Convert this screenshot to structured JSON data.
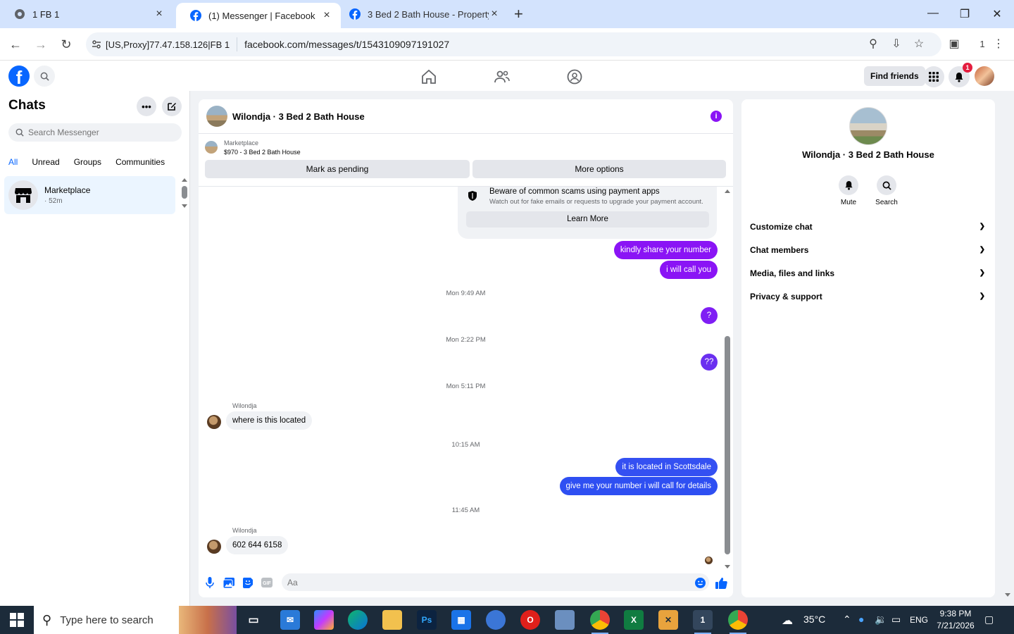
{
  "browser": {
    "tabs": [
      {
        "title": "1 FB 1",
        "active": false
      },
      {
        "title": "(1) Messenger | Facebook",
        "active": true
      },
      {
        "title": "3 Bed 2 Bath House - Property r",
        "active": false
      }
    ],
    "proxy_label": "[US,Proxy]77.47.158.126|FB 1",
    "url": "facebook.com/messages/t/1543109097191027",
    "profile_count": "1"
  },
  "fb_header": {
    "find_friends_label": "Find friends",
    "notification_count": "1"
  },
  "sidebar": {
    "title": "Chats",
    "search_placeholder": "Search Messenger",
    "filters": [
      "All",
      "Unread",
      "Groups",
      "Communities"
    ],
    "active_filter": "All",
    "chats": [
      {
        "name": "Marketplace",
        "time": "· 52m"
      }
    ]
  },
  "conversation": {
    "title": "Wilondja · 3 Bed 2 Bath House",
    "marketplace": {
      "label": "Marketplace",
      "listing": "$970 - 3 Bed 2 Bath House",
      "mark_pending_label": "Mark as pending",
      "more_options_label": "More options"
    },
    "scam_notice": {
      "title": "Beware of common scams using payment apps",
      "body": "Watch out for fake emails or requests to upgrade your payment account.",
      "button": "Learn More"
    },
    "messages": [
      {
        "from": "me",
        "text": "kindly share your number"
      },
      {
        "from": "me",
        "text": "i will call you"
      },
      {
        "timestamp": "Mon 9:49 AM"
      },
      {
        "from": "me",
        "text": "?"
      },
      {
        "timestamp": "Mon 2:22 PM"
      },
      {
        "from": "me",
        "text": "??"
      },
      {
        "timestamp": "Mon 5:11 PM"
      },
      {
        "from": "Wilondja",
        "text": "where is this located"
      },
      {
        "timestamp": "10:15 AM"
      },
      {
        "from": "me",
        "text": "it is located in Scottsdale"
      },
      {
        "from": "me",
        "text": "give me your number i will call for details"
      },
      {
        "timestamp": "11:45 AM"
      },
      {
        "from": "Wilondja",
        "text": "602 644 6158"
      }
    ],
    "composer_placeholder": "Aa",
    "colors": {
      "outgoing_top": "#8a14f5",
      "outgoing_mid": "#6a2ff0",
      "outgoing_bottom": "#2e4ff2",
      "accent": "#8a14f5"
    }
  },
  "info_panel": {
    "name": "Wilondja · 3 Bed 2 Bath House",
    "actions": [
      {
        "label": "Mute",
        "icon": "bell-icon"
      },
      {
        "label": "Search",
        "icon": "search-icon"
      }
    ],
    "sections": [
      "Customize chat",
      "Chat members",
      "Media, files and links",
      "Privacy & support"
    ]
  },
  "taskbar": {
    "search_placeholder": "Type here to search",
    "weather": "35°C",
    "language": "ENG",
    "time": "9:38 PM",
    "date": "7/21/2026",
    "notification_count": "1"
  }
}
